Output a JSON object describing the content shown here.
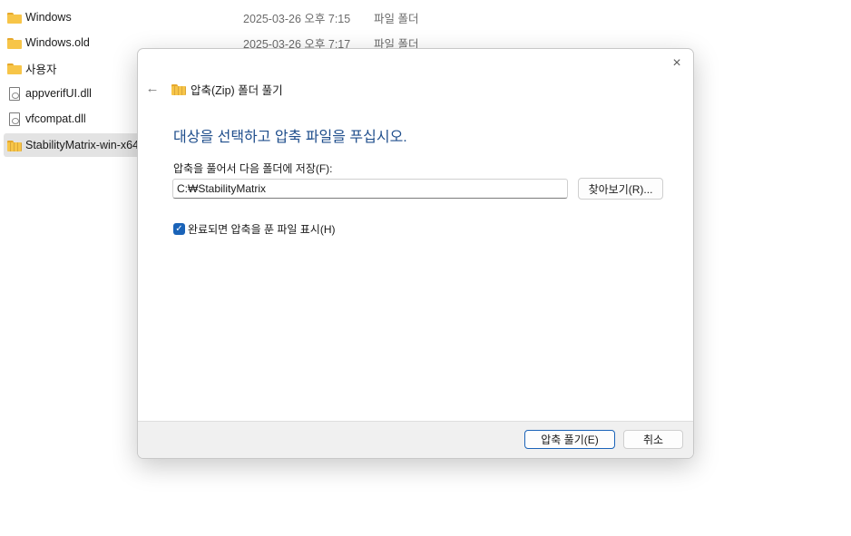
{
  "files": [
    {
      "name": "Windows",
      "date": "2025-03-26 오후 7:15",
      "type": "파일 폴더",
      "icon": "folder-icon"
    },
    {
      "name": "Windows.old",
      "date": "2025-03-26 오후 7:17",
      "type": "파일 폴더",
      "icon": "folder-icon"
    },
    {
      "name": "사용자",
      "date": "",
      "type": "",
      "icon": "folder-icon"
    },
    {
      "name": "appverifUI.dll",
      "date": "",
      "type": "",
      "icon": "document-icon"
    },
    {
      "name": "vfcompat.dll",
      "date": "",
      "type": "",
      "icon": "document-icon"
    },
    {
      "name": "StabilityMatrix-win-x64",
      "date": "",
      "type": "",
      "icon": "zip-folder-icon",
      "selected": true
    }
  ],
  "dialog": {
    "close_icon": "×",
    "back_icon": "←",
    "title": "압축(Zip) 폴더 풀기",
    "heading": "대상을 선택하고 압축 파일을 푸십시오.",
    "dest_label": "압축을 풀어서 다음 폴더에 저장(F):",
    "dest_path": "C:₩StabilityMatrix",
    "browse_label": "찾아보기(R)...",
    "show_files_checked": true,
    "checkmark": "✓",
    "show_files_label": "완료되면 압축을 푼 파일 표시(H)",
    "extract_label": "압축 풀기(E)",
    "cancel_label": "취소",
    "accent_color": "#1a63b8",
    "heading_color": "#1f4e8c"
  }
}
